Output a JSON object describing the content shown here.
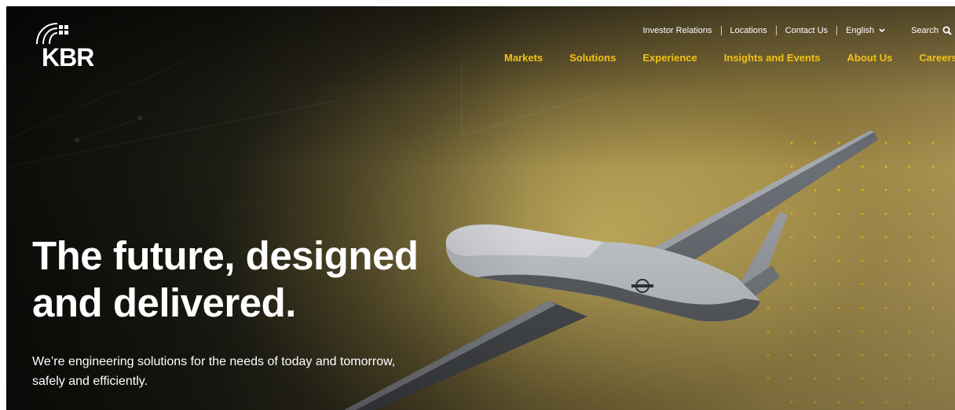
{
  "brand": {
    "name": "KBR"
  },
  "utility_nav": {
    "investor_relations": "Investor Relations",
    "locations": "Locations",
    "contact_us": "Contact Us",
    "language": "English",
    "search": "Search"
  },
  "main_nav": {
    "items": [
      "Markets",
      "Solutions",
      "Experience",
      "Insights and Events",
      "About Us",
      "Careers"
    ]
  },
  "hero": {
    "headline_line1": "The future, designed",
    "headline_line2": "and delivered.",
    "subtext_line1": "We’re engineering solutions for the needs of today and tomorrow,",
    "subtext_line2": "safely and efficiently."
  },
  "colors": {
    "accent": "#f2c214",
    "text": "#ffffff"
  },
  "icons": [
    "globe-icon",
    "chevron-down-icon",
    "search-icon"
  ]
}
